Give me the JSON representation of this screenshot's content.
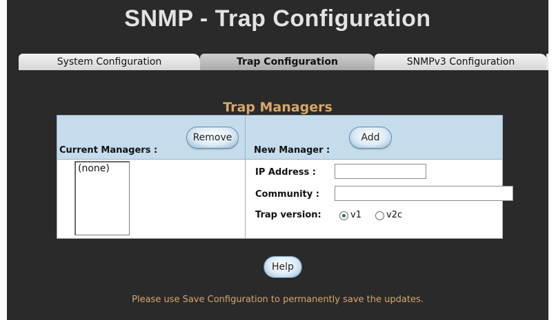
{
  "page": {
    "title": "SNMP - Trap Configuration"
  },
  "tabs": [
    {
      "label": "System Configuration",
      "active": false
    },
    {
      "label": "Trap Configuration",
      "active": true
    },
    {
      "label": "SNMPv3 Configuration",
      "active": false
    }
  ],
  "section": {
    "title": "Trap Managers"
  },
  "current": {
    "label": "Current Managers :",
    "remove_label": "Remove",
    "list_items": [
      "(none)"
    ]
  },
  "new_manager": {
    "label": "New Manager :",
    "add_label": "Add",
    "ip_label": "IP Address :",
    "ip_value": "",
    "community_label": "Community :",
    "community_value": "",
    "trap_version_label": "Trap version:",
    "versions": [
      {
        "label": "v1",
        "checked": true
      },
      {
        "label": "v2c",
        "checked": false
      }
    ]
  },
  "help_label": "Help",
  "note": "Please use Save Configuration to permanently save the updates.",
  "colors": {
    "background": "#2a2a2a",
    "title": "#e3e3e3",
    "accent_orange": "#d7a86b",
    "table_header": "#c5dcec"
  }
}
